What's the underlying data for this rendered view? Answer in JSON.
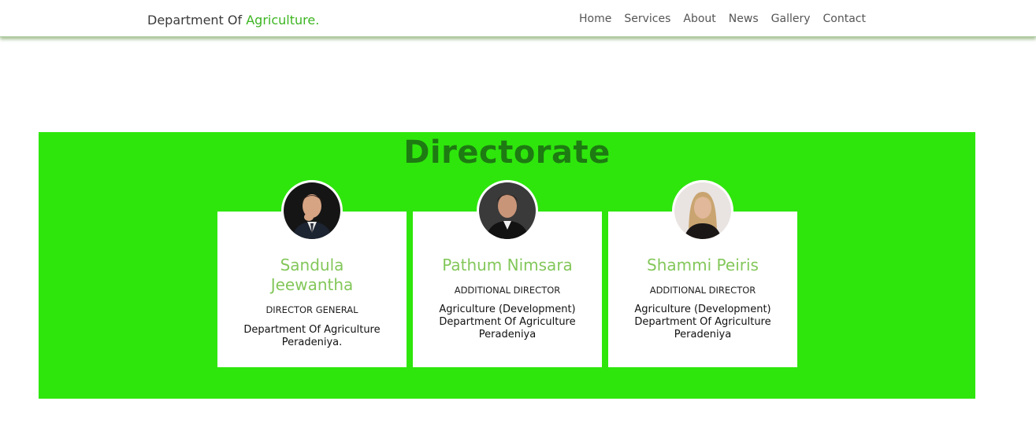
{
  "header": {
    "brand_prefix": "Department Of ",
    "brand_accent": "Agriculture.",
    "nav": [
      "Home",
      "Services",
      "About",
      "News",
      "Gallery",
      "Contact"
    ]
  },
  "directorate": {
    "title": "Directorate",
    "members": [
      {
        "name": "Sandula Jeewantha",
        "role": "DIRECTOR GENERAL",
        "desc": [
          "Department Of Agriculture",
          "Peradeniya."
        ],
        "avatar": "man-portrait-suit-hand-on-chin"
      },
      {
        "name": "Pathum Nimsara",
        "role": "ADDITIONAL DIRECTOR",
        "desc": [
          "Agriculture (Development)",
          "Department Of Agriculture",
          "Peradeniya"
        ],
        "avatar": "man-portrait-dark-jacket"
      },
      {
        "name": "Shammi Peiris",
        "role": "ADDITIONAL DIRECTOR",
        "desc": [
          "Agriculture (Development)",
          "Department Of Agriculture",
          "Peradeniya"
        ],
        "avatar": "woman-portrait-blonde"
      }
    ]
  },
  "colors": {
    "accent_green": "#3cb521",
    "section_bg": "#2ee60c",
    "title_green": "#1e7a12",
    "name_green": "#83c75a"
  }
}
